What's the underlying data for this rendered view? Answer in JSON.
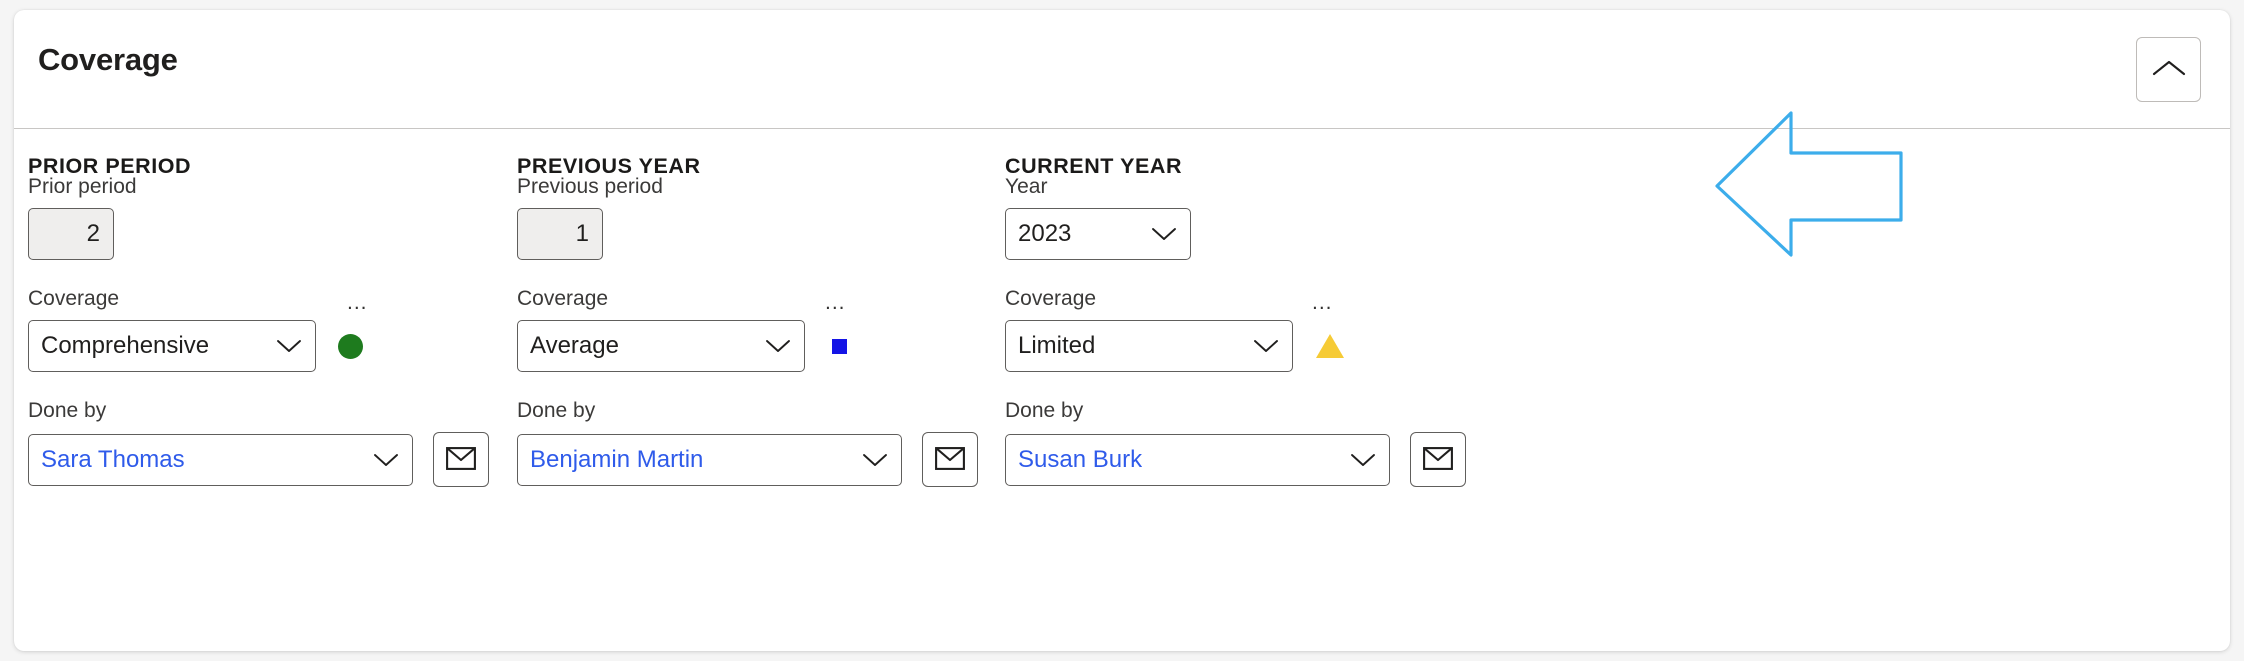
{
  "card": {
    "title": "Coverage",
    "collapse_icon": "chevron-up-icon",
    "collapse_label": "Collapse"
  },
  "columns": [
    {
      "section_title": "PRIOR PERIOD",
      "period_label": "Prior period",
      "period_value": "2",
      "period_control": "readonly-number",
      "coverage_label": "Coverage",
      "coverage_value": "Comprehensive",
      "coverage_overflow": "...",
      "status_icon": "green-circle-icon",
      "status_color": "#1e7b1e",
      "status_shape": "circle",
      "doneby_label": "Done by",
      "doneby_value": "Sara Thomas",
      "mail_icon": "envelope-icon"
    },
    {
      "section_title": "PREVIOUS YEAR",
      "period_label": "Previous period",
      "period_value": "1",
      "period_control": "readonly-number",
      "coverage_label": "Coverage",
      "coverage_value": "Average",
      "coverage_overflow": "...",
      "status_icon": "blue-square-icon",
      "status_color": "#1414e6",
      "status_shape": "square",
      "doneby_label": "Done by",
      "doneby_value": "Benjamin Martin",
      "mail_icon": "envelope-icon"
    },
    {
      "section_title": "CURRENT YEAR",
      "period_label": "Year",
      "period_value": "2023",
      "period_control": "dropdown",
      "coverage_label": "Coverage",
      "coverage_value": "Limited",
      "coverage_overflow": "...",
      "status_icon": "warning-triangle-icon",
      "status_color": "#f6cb36",
      "status_shape": "triangle",
      "doneby_label": "Done by",
      "doneby_value": "Susan Burk",
      "mail_icon": "envelope-icon"
    }
  ],
  "annotation": {
    "shape": "left-arrow-outline",
    "color": "#3cadeb"
  },
  "theme": {
    "link_color": "#2f5bea",
    "border_color": "#605e5c",
    "text_color": "#201f1e",
    "page_background": "#f5f5f5",
    "card_background": "#ffffff"
  }
}
